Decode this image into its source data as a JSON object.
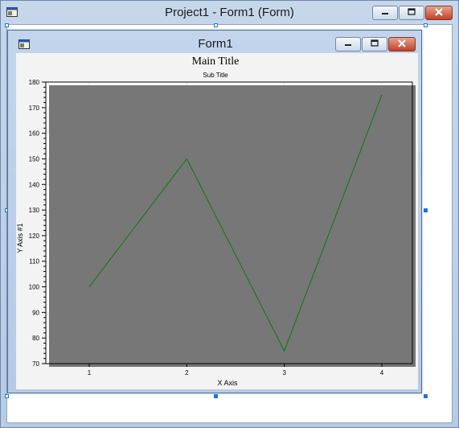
{
  "outer_window": {
    "title": "Project1 - Form1 (Form)",
    "buttons": [
      "minimize",
      "maximize",
      "close"
    ]
  },
  "form_window": {
    "title": "Form1",
    "buttons": [
      "minimize",
      "maximize",
      "close"
    ]
  },
  "chart_data": {
    "type": "line",
    "title": "Main Title",
    "subtitle": "Sub Title",
    "xlabel": "X Axis",
    "ylabel": "Y Axis #1",
    "categories": [
      "1",
      "2",
      "3",
      "4"
    ],
    "series": [
      {
        "values": [
          100,
          150,
          75,
          175
        ],
        "color": "#0a7a0a"
      }
    ],
    "ylim": [
      70,
      180
    ],
    "y_ticks": [
      70,
      80,
      90,
      100,
      110,
      120,
      130,
      140,
      150,
      160,
      170,
      180
    ],
    "grid": true,
    "legend": "none"
  },
  "colors": {
    "line": "#0a7a0a",
    "plot_band_a": "#ffffff",
    "plot_band_b": "#f3f3f3",
    "selection_handle": "#1e74d8"
  }
}
